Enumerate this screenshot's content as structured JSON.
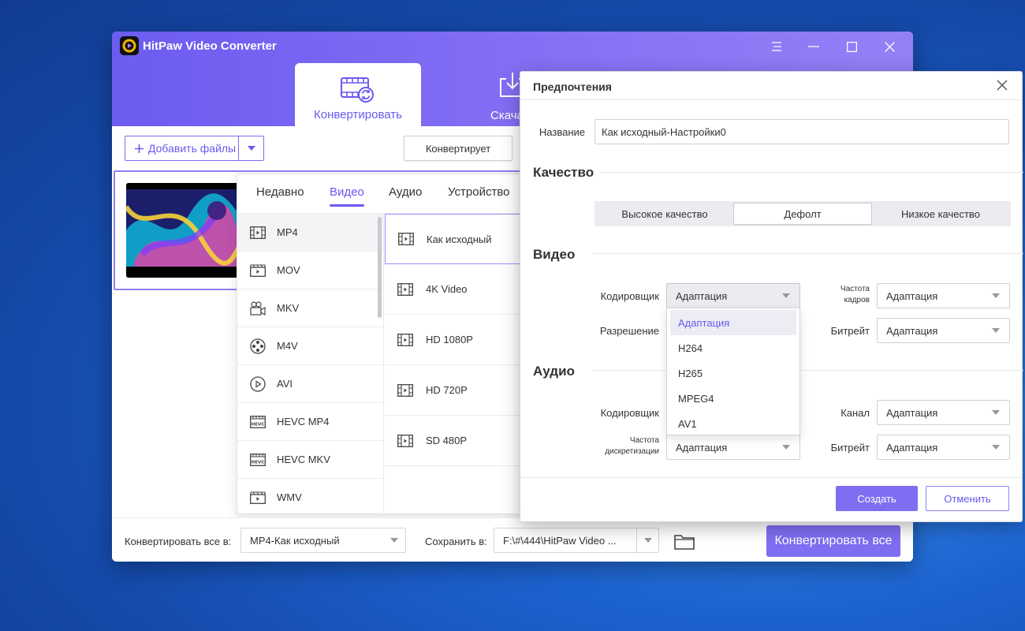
{
  "app": {
    "title": "HitPaw Video Converter",
    "tabs": [
      {
        "label": "Конвертировать",
        "icon": "film-convert-icon"
      },
      {
        "label": "Скача",
        "icon": "download-icon"
      }
    ],
    "window_controls": [
      "menu-icon",
      "minimize-icon",
      "maximize-icon",
      "close-icon"
    ],
    "add_files_label": "Добавить файлы",
    "convert_label": "Конвертирует",
    "accent": "#7e6ef2"
  },
  "format_panel": {
    "tabs": [
      "Недавно",
      "Видео",
      "Аудио",
      "Устройство"
    ],
    "active_tab": "Видео",
    "formats": [
      "MP4",
      "MOV",
      "MKV",
      "M4V",
      "AVI",
      "HEVC MP4",
      "HEVC MKV",
      "WMV"
    ],
    "selected_format": "MP4",
    "resolutions": [
      "Как исходный",
      "4K Video",
      "HD 1080P",
      "HD 720P",
      "SD 480P"
    ],
    "selected_resolution": "Как исходный"
  },
  "bottom_bar": {
    "convert_all_in_label": "Конвертировать все в:",
    "convert_all_in_value": "MP4-Как исходный",
    "save_in_label": "Сохранить в:",
    "save_in_value": "F:\\#\\444\\HitPaw Video ...",
    "convert_all_button": "Конвертировать все"
  },
  "dialog": {
    "title": "Предпочтения",
    "name_label": "Название",
    "name_value": "Как исходный-Настройки0",
    "quality_section": "Качество",
    "quality_options": [
      "Высокое качество",
      "Дефолт",
      "Низкое качество"
    ],
    "quality_selected": "Дефолт",
    "video_section": "Видео",
    "video_encoder_label": "Кодировщик",
    "video_encoder_value": "Адаптация",
    "frame_rate_label_1": "Частота",
    "frame_rate_label_2": "кадров",
    "frame_rate_value": "Адаптация",
    "resolution_label": "Разрешение",
    "video_bitrate_label": "Битрейт",
    "video_bitrate_value": "Адаптация",
    "encoder_options": [
      "Адаптация",
      "H264",
      "H265",
      "MPEG4",
      "AV1"
    ],
    "encoder_selected": "Адаптация",
    "audio_section": "Аудио",
    "audio_encoder_label": "Кодировщик",
    "channel_label": "Канал",
    "channel_value": "Адаптация",
    "sample_rate_label_1": "Частота",
    "sample_rate_label_2": "дискретизации",
    "sample_rate_value": "Адаптация",
    "audio_bitrate_label": "Битрейт",
    "audio_bitrate_value": "Адаптация",
    "create_button": "Создать",
    "cancel_button": "Отменить"
  }
}
